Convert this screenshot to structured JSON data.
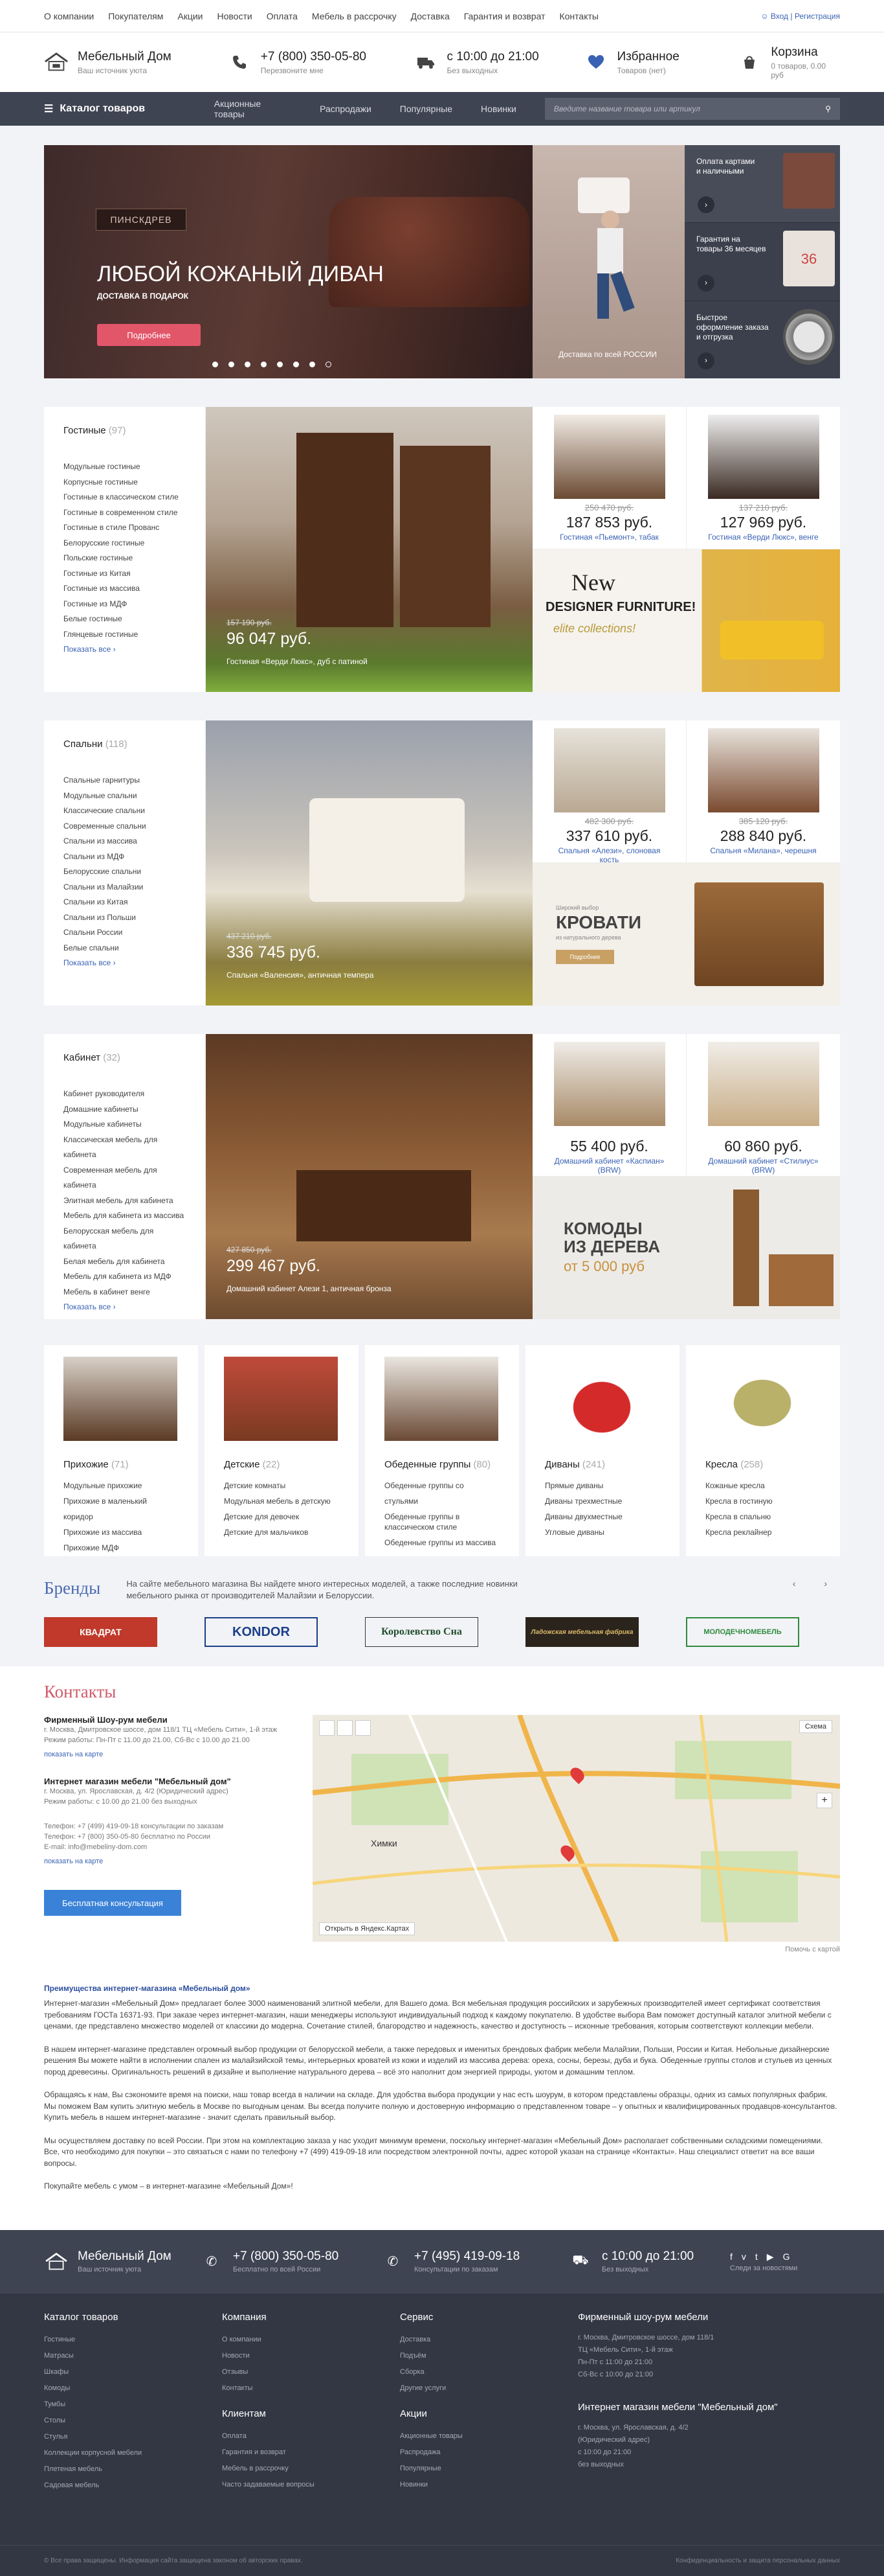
{
  "topnav": [
    "О компании",
    "Покупателям",
    "Акции",
    "Новости",
    "Оплата",
    "Мебель в рассрочку",
    "Доставка",
    "Гарантия и возврат",
    "Контакты"
  ],
  "auth": {
    "login": "Вход",
    "sep": "|",
    "register": "Регистрация"
  },
  "header": {
    "logo_name": "Мебельный Дом",
    "logo_sub": "Ваш источник уюта",
    "phone": "+7 (800) 350-05-80",
    "phone_sub": "Перезвоните мне",
    "hours": "с 10:00 до 21:00",
    "hours_sub": "Без выходных",
    "fav": "Избранное",
    "fav_sub": "Товаров (нет)",
    "cart": "Корзина",
    "cart_sub": "0 товаров, 0.00 руб"
  },
  "nav": {
    "catalog": "Каталог товаров",
    "links": [
      "Акционные товары",
      "Распродажи",
      "Популярные",
      "Новинки"
    ],
    "search_placeholder": "Введите название товара или артикул"
  },
  "hero": {
    "brand": "ПИНСКДРЕВ",
    "title": "ЛЮБОЙ КОЖАНЫЙ ДИВАН",
    "subtitle": "ДОСТАВКА В ПОДАРОК",
    "button": "Подробнее",
    "mid_caption": "Доставка по всей РОССИИ",
    "side": [
      "Оплата картами и наличными",
      "Гарантия на товары 36 месяцев",
      "Быстрое оформление заказа и отгрузка"
    ],
    "badge": "36"
  },
  "living": {
    "title": "Гостиные",
    "count": "(97)",
    "items": [
      "Модульные гостиные",
      "Корпусные гостиные",
      "Гостиные в классическом стиле",
      "Гостиные в современном стиле",
      "Гостиные в стиле Прованс",
      "Белорусские гостиные",
      "Польские гостиные",
      "Гостиные из Китая",
      "Гостиные из массива",
      "Гостиные из МДФ",
      "Белые гостиные",
      "Глянцевые гостиные"
    ],
    "more": "Показать все",
    "big": {
      "old": "157 190 руб.",
      "price": "96 047 руб.",
      "name": "Гостиная «Верди Люкс», дуб с патиной"
    },
    "cards": [
      {
        "old": "250 470 руб.",
        "price": "187 853 руб.",
        "name": "Гостиная «Пьемонт», табак"
      },
      {
        "old": "137 210 руб.",
        "price": "127 969 руб.",
        "name": "Гостиная «Верди Люкс», венге"
      }
    ],
    "banner": {
      "l1": "New",
      "l2": "DESIGNER FURNITURE!",
      "l3": "elite collections!"
    }
  },
  "bedroom": {
    "title": "Спальни",
    "count": "(118)",
    "items": [
      "Спальные гарнитуры",
      "Модульные спальни",
      "Классические спальни",
      "Современные спальни",
      "Спальни из массива",
      "Спальни из МДФ",
      "Белорусские спальни",
      "Спальни из Малайзии",
      "Спальни из Китая",
      "Спальни из Польши",
      "Спальни России",
      "Белые спальни"
    ],
    "more": "Показать все",
    "big": {
      "old": "437 210 руб.",
      "price": "336 745 руб.",
      "name": "Спальня «Валенсия», античная темпера"
    },
    "cards": [
      {
        "old": "482 300 руб.",
        "price": "337 610 руб.",
        "name": "Спальня «Алези», слоновая кость"
      },
      {
        "old": "385 120 руб.",
        "price": "288 840 руб.",
        "name": "Спальня «Милана», черешня"
      }
    ],
    "banner": {
      "l0": "Широкий выбор",
      "l1": "КРОВАТИ",
      "l2": "из натурального дерева",
      "btn": "Подробнее"
    }
  },
  "office": {
    "title": "Кабинет",
    "count": "(32)",
    "items": [
      "Кабинет руководителя",
      "Домашние кабинеты",
      "Модульные кабинеты",
      "Классическая мебель для кабинета",
      "Современная мебель для кабинета",
      "Элитная мебель для кабинета",
      "Мебель для кабинета из массива",
      "Белорусская мебель для кабинета",
      "Белая мебель для кабинета",
      "Мебель для кабинета из МДФ",
      "Мебель в кабинет венге"
    ],
    "more": "Показать все",
    "big": {
      "old": "427 850 руб.",
      "price": "299 467 руб.",
      "name": "Домашний кабинет Алези 1, античная бронза"
    },
    "cards": [
      {
        "price": "55 400 руб.",
        "name": "Домашний кабинет «Каспиан» (BRW)"
      },
      {
        "price": "60 860 руб.",
        "name": "Домашний кабинет «Стилиус» (BRW)"
      }
    ],
    "banner": {
      "l1": "КОМОДЫ",
      "l2": "ИЗ ДЕРЕВА",
      "l3": "от",
      "l4": "5 000 руб"
    }
  },
  "smalls": [
    {
      "title": "Прихожие",
      "count": "(71)",
      "items": [
        "Модульные прихожие",
        "Прихожие в маленький коридор",
        "Прихожие из массива",
        "Прихожие МДФ"
      ]
    },
    {
      "title": "Детские",
      "count": "(22)",
      "items": [
        "Детские комнаты",
        "Модульная мебель в детскую",
        "Детские для девочек",
        "Детские для мальчиков"
      ]
    },
    {
      "title": "Обеденные группы",
      "count": "(80)",
      "items": [
        "Обеденные группы со стульями",
        "Обеденные группы в классическом стиле",
        "Обеденные группы из массива"
      ]
    },
    {
      "title": "Диваны",
      "count": "(241)",
      "items": [
        "Прямые диваны",
        "Диваны трехместные",
        "Диваны двухместные",
        "Угловые диваны"
      ]
    },
    {
      "title": "Кресла",
      "count": "(258)",
      "items": [
        "Кожаные кресла",
        "Кресла в гостиную",
        "Кресла в спальню",
        "Кресла реклайнер"
      ]
    }
  ],
  "brands": {
    "title": "Бренды",
    "text": "На сайте мебельного магазина Вы найдете много интересных моделей, а также последние новинки мебельного рынка от производителей Малайзии и Белоруссии.",
    "arrows": "‹ ›",
    "logos": [
      "КВАДРАТ",
      "KONDOR",
      "Королевство Сна",
      "Ладожская мебельная фабрика",
      "МОЛОДЕЧНОМЕБЕЛЬ"
    ]
  },
  "contacts": {
    "title": "Контакты",
    "shop1": "Фирменный Шоу-рум мебели",
    "shop1_addr": "г. Москва, Дмитровское шоссе, дом 118/1 ТЦ «Мебель Сити», 1-й этаж",
    "shop1_hours": "Режим работы: Пн-Пт с 11.00 до 21.00, Сб-Вс с 10.00 до 21.00",
    "shop1_link": "показать на карте",
    "shop2": "Интернет магазин мебели \"Мебельный дом\"",
    "shop2_addr": "г. Москва, ул. Ярославская, д. 4/2 (Юридический адрес)",
    "shop2_hours": "Режим работы: с 10.00 до 21.00 без выходных",
    "shop2_link": "показать на карте",
    "phone1": "Телефон: +7 (499) 419-09-18 консультации по заказам",
    "phone2": "Телефон: +7 (800) 350-05-80 бесплатно по России",
    "email": "E-mail: info@mebeliny-dom.com",
    "button": "Бесплатная консультация",
    "map_scheme": "Схема",
    "map_city": "Химки",
    "map_open": "Открыть в Яндекс.Картах",
    "map_feedback": "Помочь с картой"
  },
  "seo": {
    "title": "Преимущества интернет-магазина «Мебельный дом»",
    "p": [
      "Интернет-магазин «Мебельный Дом» предлагает более 3000 наименований элитной мебели, для Вашего дома. Вся мебельная продукция российских и зарубежных производителей имеет сертификат соответствия требованиям ГОСТа 16371-93. При заказе через интернет-магазин, наши менеджеры используют индивидуальный подход к каждому покупателю. В удобстве выбора Вам поможет доступный каталог элитной мебели с ценами, где представлено множество моделей от классики до модерна. Сочетание стилей, благородство и надежность, качество и доступность – исконные требования, которым соответствуют коллекции мебели.",
      "В нашем интернет-магазине представлен огромный выбор продукции от белорусской мебели, а также передовых и именитых брендовых фабрик мебели Малайзии, Польши, России и Китая. Небольные дизайнерские решения Вы можете найти в исполнении спален из малайзийской темы, интерьерных кроватей из кожи и изделий из массива дерева: ореха, сосны, березы, дуба и бука. Обеденные группы столов и стульев из ценных пород древесины. Оригинальность решений в дизайне и выполнение натурального дерева – всё это наполнит дом энергией природы, уютом и домашним теплом.",
      "Обращаясь к нам, Вы сэкономите время на поиски, наш товар всегда в наличии на складе. Для удобства выбора продукции у нас есть шоурум, в котором представлены образцы, одних из самых популярных фабрик. Мы поможем Вам купить элитную мебель в Москве по выгодным ценам. Вы всегда получите полную и достоверную информацию о представленном товаре – у опытных и квалифицированных продавцов-консультантов. Купить мебель в нашем интернет-магазине - значит сделать правильный выбор.",
      "Мы осуществляем доставку по всей России. При этом на комплектацию заказа у нас уходит минимум времени, поскольку интернет-магазин «Мебельный Дом» располагает собственными складскими помещениями. Все, что необходимо для покупки – это связаться с нами по телефону +7 (499) 419-09-18 или посредством электронной почты, адрес которой указан на странице «Контакты». Наш специалист ответит на все ваши вопросы.",
      "Покупайте мебель с умом – в интернет-магазине «Мебельный Дом»!"
    ]
  },
  "footer": {
    "logo_name": "Мебельный Дом",
    "logo_sub": "Ваш источник уюта",
    "phone1": "+7 (800) 350-05-80",
    "phone1_sub": "Бесплатно по всей России",
    "phone2": "+7 (495) 419-09-18",
    "phone2_sub": "Консультации по заказам",
    "hours": "с 10:00 до 21:00",
    "hours_sub": "Без выходных",
    "social_sub": "Следи за новостями",
    "col1": {
      "h": "Каталог товаров",
      "items": [
        "Гостиные",
        "Матрасы",
        "Шкафы",
        "Комоды",
        "Тумбы",
        "Столы",
        "Стулья",
        "Коллекции корпусной мебели",
        "Плетеная мебель",
        "Садовая мебель"
      ]
    },
    "col2": {
      "h": "Компания",
      "items": [
        "О компании",
        "Новости",
        "Отзывы",
        "Контакты"
      ],
      "h2": "Клиентам",
      "items2": [
        "Оплата",
        "Гарантия и возврат",
        "Мебель в рассрочку",
        "Часто задаваемые вопросы"
      ]
    },
    "col3": {
      "h": "Сервис",
      "items": [
        "Доставка",
        "Подъём",
        "Сборка",
        "Другие услуги"
      ],
      "h2": "Акции",
      "items2": [
        "Акционные товары",
        "Распродажа",
        "Популярные",
        "Новинки"
      ]
    },
    "col4": {
      "h": "Фирменный шоу-рум мебели",
      "items": [
        "г. Москва, Дмитровское шоссе, дом 118/1",
        "ТЦ «Мебель Сити», 1-й этаж",
        "Пн-Пт с 11:00 до 21:00",
        "Сб-Вс с 10:00 до 21:00"
      ],
      "h2": "Интернет магазин мебели \"Мебельный дом\"",
      "items2": [
        "г. Москва, ул. Ярославская, д. 4/2",
        "(Юридический адрес)",
        "с 10:00 до 21:00",
        "без выходных"
      ]
    },
    "copyright": "© Все права защищены. Информация сайта защищена законом об авторских правах.",
    "privacy": "Конфиденциальность и защита персональных данных"
  }
}
